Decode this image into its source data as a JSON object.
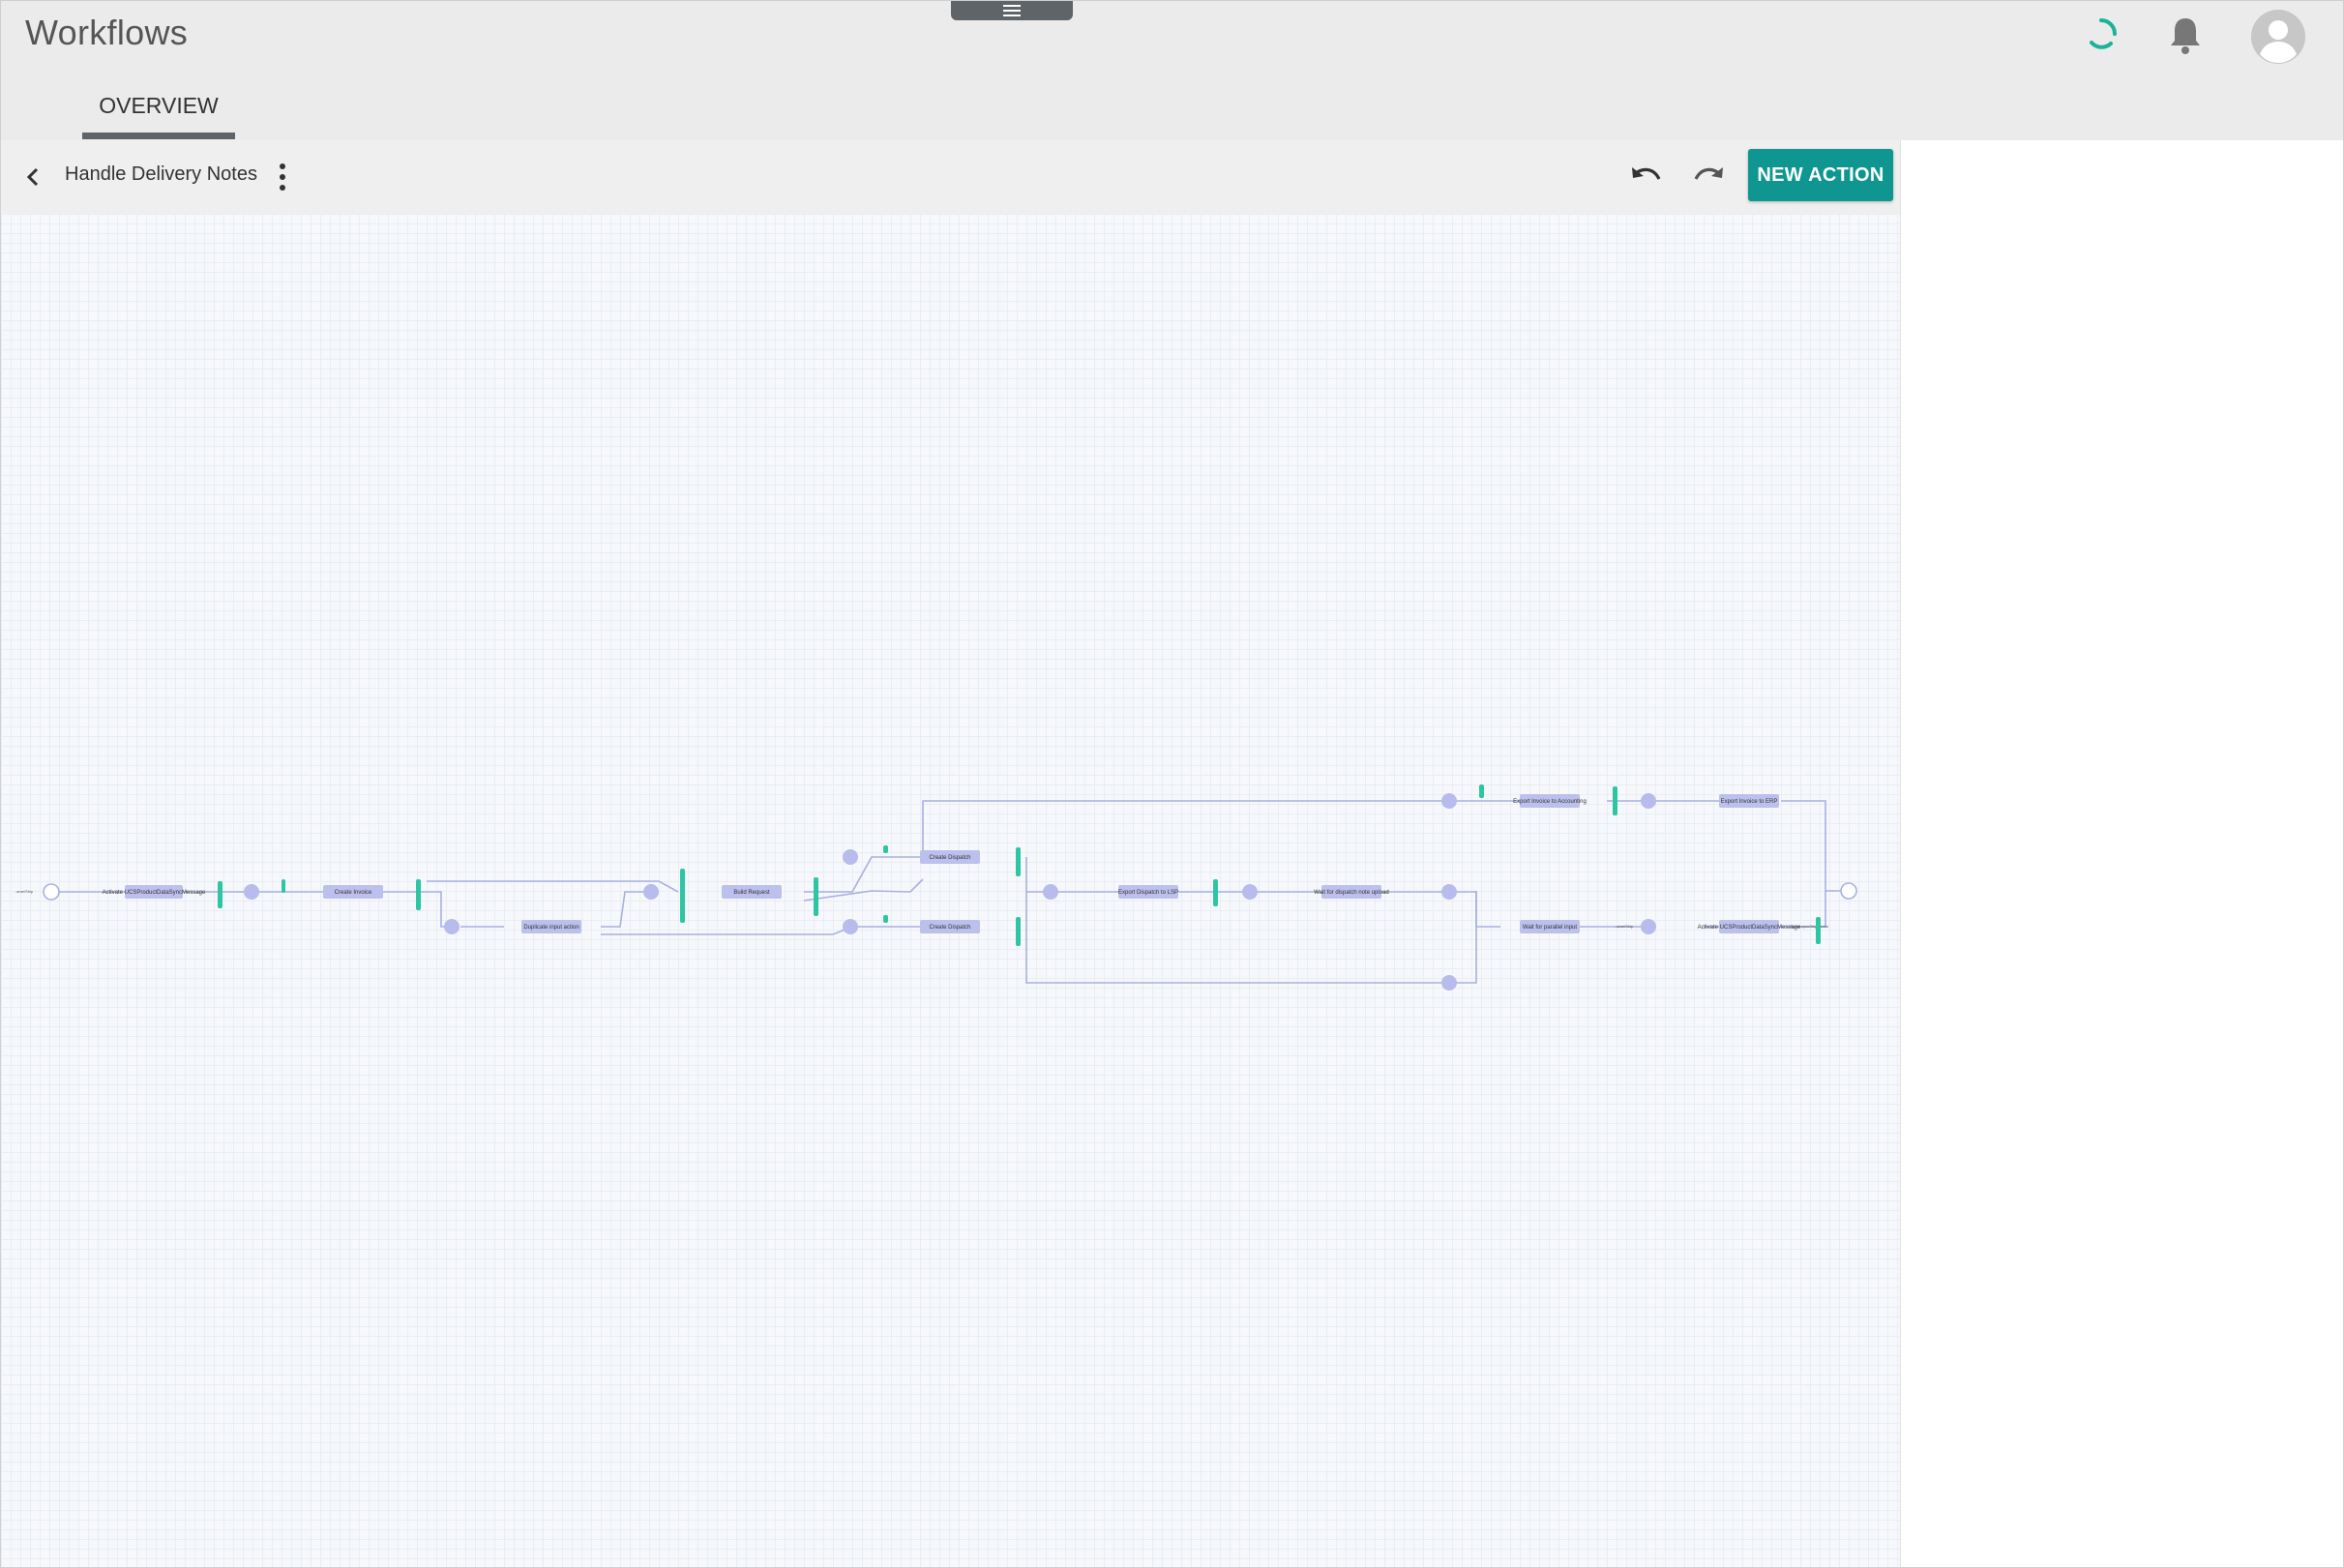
{
  "app": {
    "title": "Workflows"
  },
  "tabs": [
    {
      "label": "OVERVIEW",
      "active": true
    }
  ],
  "toolbar": {
    "workflow_name": "Handle Delivery Notes",
    "new_action_label": "NEW ACTION"
  },
  "colors": {
    "accent": "#0f9691",
    "node": "#bcc0ec",
    "edge": "#a9b0e0",
    "port": "#2ec5a4",
    "spinner": "#19b39a"
  },
  "icons": {
    "back": "chevron-left-icon",
    "menu": "more-vert-icon",
    "undo": "undo-icon",
    "redo": "redo-icon",
    "bell": "bell-icon",
    "avatar": "account-circle-icon",
    "spinner": "loading-spinner-icon",
    "drawer": "menu-icon"
  },
  "diagram": {
    "nodes": {
      "n1": "Activate UCSProductDataSyncMessage",
      "n2": "Create Invoice",
      "n3": "Duplicate input action",
      "n4": "Build Request",
      "n5": "Create Dispatch",
      "n6": "Create Dispatch",
      "n7": "Export Dispatch to LSP",
      "n8": "Wait for dispatch note upload",
      "n9": "Wait for parallel input",
      "n10": "Activate UCSProductDataSyncMessage",
      "n11": "Export Invoice to Accounting",
      "n12": "Export Invoice to ERP"
    },
    "labels": {
      "start": "..ame/Ship",
      "mid": "..ame/Ship",
      "end": "...Types.syncShipments/"
    }
  }
}
